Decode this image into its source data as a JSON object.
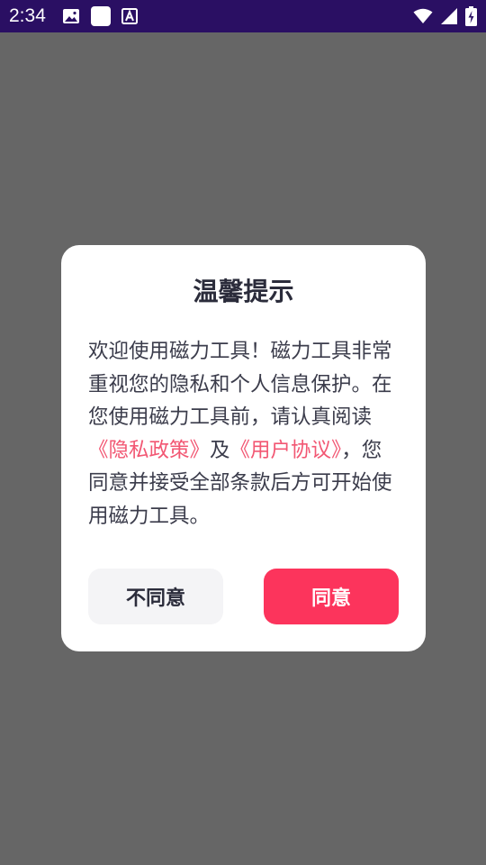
{
  "status_bar": {
    "time": "2:34",
    "left_icons": [
      "image-icon",
      "app-square-icon",
      "font-a-icon"
    ],
    "right_icons": [
      "wifi-icon",
      "signal-icon",
      "battery-charging-icon"
    ]
  },
  "dialog": {
    "title": "温馨提示",
    "body": {
      "part1": "欢迎使用磁力工具！磁力工具非常重视您的隐私和个人信息保护。在您使用磁力工具前，请认真阅读",
      "privacy_link": "《隐私政策》",
      "conj": "及",
      "agreement_link": "《用户协议》",
      "part2": "，您同意并接受全部条款后方可开始使用磁力工具。"
    },
    "disagree_label": "不同意",
    "agree_label": "同意"
  },
  "colors": {
    "status_bar_bg": "#2a0f63",
    "scrim": "#666666",
    "link": "#f25773",
    "agree_bg": "#fc345c",
    "disagree_bg": "#f4f4f6"
  }
}
